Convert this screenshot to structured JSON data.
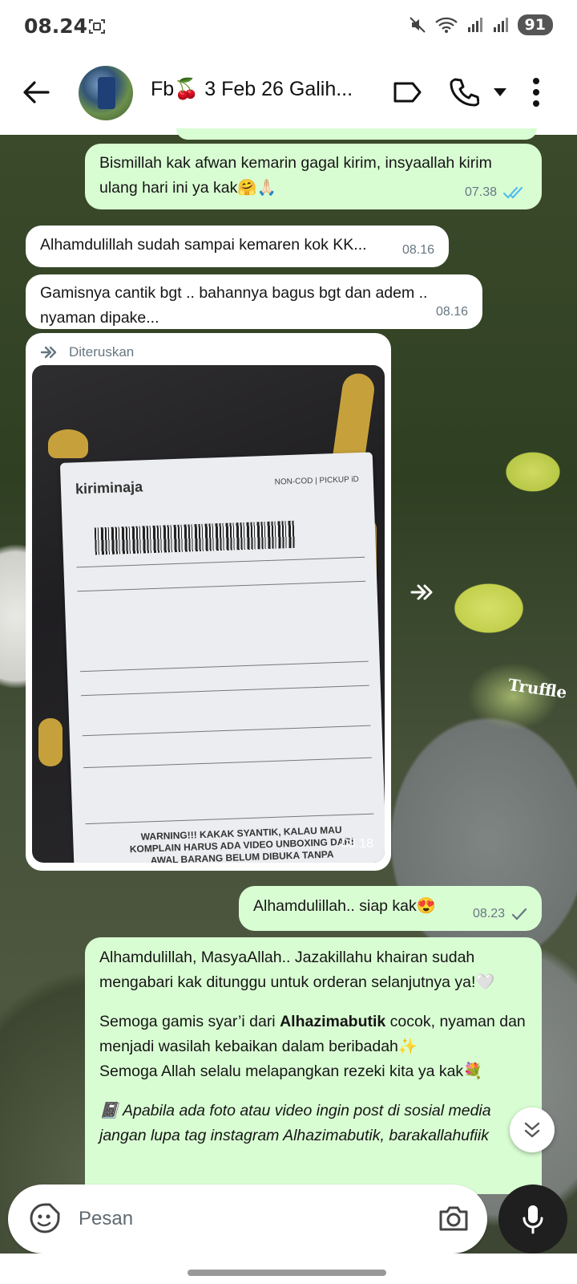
{
  "status_bar": {
    "time": "08.24",
    "battery": "91"
  },
  "header": {
    "title": "Fb🍒 3 Feb 26 Galih..."
  },
  "messages": {
    "m1": {
      "text": "Bismillah kak afwan kemarin gagal kirim, insyaallah kirim ulang hari ini ya kak🤗🙏🏻",
      "time": "07.38"
    },
    "m2": {
      "text": "Alhamdulillah sudah sampai kemaren kok KK...",
      "time": "08.16"
    },
    "m3": {
      "text": "Gamisnya cantik bgt .. bahannya bagus bgt dan adem .. nyaman dipake...",
      "time": "08.16"
    },
    "m4": {
      "forwarded_label": "Diteruskan",
      "time": "08.18",
      "label_brand": "kiriminaja",
      "label_header": "NON-COD | PICKUP iD",
      "label_warning": "WARNING!!! KAKAK SYANTIK, KALAU MAU KOMPLAIN HARUS ADA VIDEO UNBOXING DARI AWAL BARANG BELUM DIBUKA TANPA"
    },
    "m5": {
      "text": "Alhamdulillah.. siap kak😍",
      "time": "08.23"
    },
    "m6": {
      "p1": "Alhamdulillah, MasyaAllah.. Jazakillahu khairan sudah mengabari kak ditunggu untuk orderan selanjutnya ya!🤍",
      "p2_before": "Semoga gamis syar’i dari ",
      "p2_bold": "Alhazimabutik",
      "p2_after": " cocok, nyaman dan menjadi wasilah kebaikan dalam beribadah✨",
      "p3": "Semoga Allah selalu melapangkan rezeki kita ya kak💐",
      "p4": "📓 Apabila ada foto atau video ingin post di sosial media jangan lupa tag instagram Alhazimabutik, barakallahufiik"
    }
  },
  "background_text": "Truffle",
  "composer": {
    "placeholder": "Pesan"
  },
  "colors": {
    "outgoing": "#d9fdd3",
    "incoming": "#ffffff",
    "read_tick": "#53bdeb",
    "sent_tick": "#667781"
  }
}
